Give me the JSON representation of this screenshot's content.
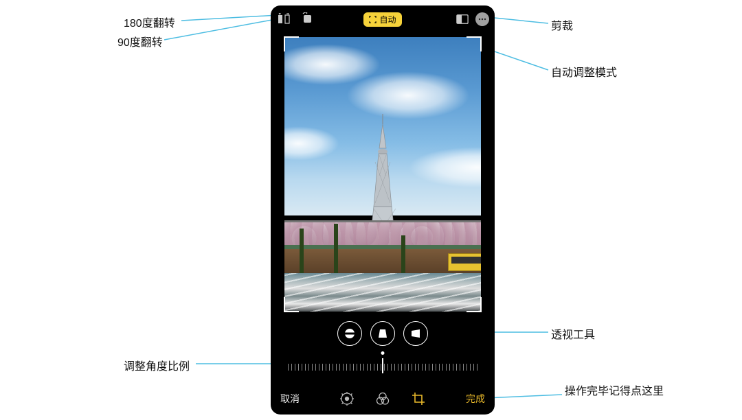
{
  "topbar": {
    "auto_label": "自动",
    "flip_h_name": "flip-180",
    "rotate_name": "rotate-90",
    "aspect_name": "aspect-ratio",
    "more_name": "more"
  },
  "perspective": {
    "straighten": "straighten",
    "vertical": "vertical-perspective",
    "horizontal": "horizontal-perspective"
  },
  "bottombar": {
    "cancel": "取消",
    "done": "完成",
    "mode_adjust": "adjust",
    "mode_filters": "filters",
    "mode_crop": "crop"
  },
  "annotations": {
    "flip180": "180度翻转",
    "rotate90": "90度翻转",
    "crop": "剪裁",
    "auto_adjust": "自动调整模式",
    "perspective_tools": "透视工具",
    "angle_ratio": "调整角度比例",
    "done_hint": "操作完毕记得点这里"
  }
}
